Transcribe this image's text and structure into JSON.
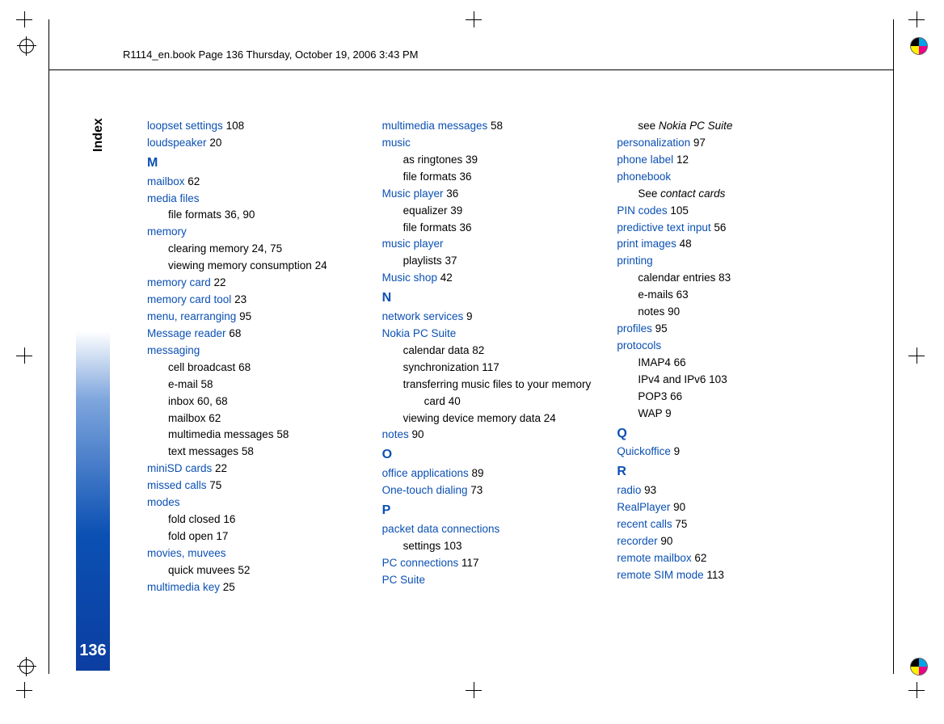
{
  "header": "R1114_en.book  Page 136  Thursday, October 19, 2006  3:43 PM",
  "side_label": "Index",
  "page_number": "136",
  "col1": {
    "loopset_settings": "loopset settings",
    "loopset_settings_pg": "108",
    "loudspeaker": "loudspeaker",
    "loudspeaker_pg": "20",
    "M": "M",
    "mailbox": "mailbox",
    "mailbox_pg": "62",
    "media_files": "media files",
    "mf_file_formats": "file formats",
    "mf_file_formats_pg": "36, 90",
    "memory": "memory",
    "mem_clearing": "clearing memory",
    "mem_clearing_pg": "24, 75",
    "mem_viewing": "viewing memory consumption",
    "mem_viewing_pg": "24",
    "memory_card": "memory card",
    "memory_card_pg": "22",
    "memory_card_tool": "memory card tool",
    "memory_card_tool_pg": "23",
    "menu_rearranging": "menu, rearranging",
    "menu_rearranging_pg": "95",
    "message_reader": "Message reader",
    "message_reader_pg": "68",
    "messaging": "messaging",
    "msg_cb": "cell broadcast",
    "msg_cb_pg": "68",
    "msg_email": "e-mail",
    "msg_email_pg": "58",
    "msg_inbox": "inbox",
    "msg_inbox_pg": "60, 68",
    "msg_mailbox": "mailbox",
    "msg_mailbox_pg": "62",
    "msg_mm": "multimedia messages",
    "msg_mm_pg": "58",
    "msg_text": "text messages",
    "msg_text_pg": "58",
    "mini_sd": "miniSD cards",
    "mini_sd_pg": "22",
    "missed_calls": "missed calls",
    "missed_calls_pg": "75",
    "modes": "modes",
    "fold_closed": "fold closed",
    "fold_closed_pg": "16",
    "fold_open": "fold open",
    "fold_open_pg": "17",
    "movies": "movies, muvees",
    "quick_muvees": "quick muvees",
    "quick_muvees_pg": "52",
    "mm_key": "multimedia key",
    "mm_key_pg": "25"
  },
  "col2": {
    "mm_messages": "multimedia messages",
    "mm_messages_pg": "58",
    "music": "music",
    "ringtones": "as ringtones",
    "ringtones_pg": "39",
    "music_ff": "file formats",
    "music_ff_pg": "36",
    "music_player_cap": "Music player",
    "music_player_cap_pg": "36",
    "equalizer": "equalizer",
    "equalizer_pg": "39",
    "mp_ff": "file formats",
    "mp_ff_pg": "36",
    "music_player_lc": "music player",
    "playlists": "playlists",
    "playlists_pg": "37",
    "music_shop": "Music shop",
    "music_shop_pg": "42",
    "N": "N",
    "network_services": "network services",
    "network_services_pg": "9",
    "nokia_pc": "Nokia PC Suite",
    "npc_cal": "calendar data",
    "npc_cal_pg": "82",
    "npc_sync": "synchronization",
    "npc_sync_pg": "117",
    "npc_transfer": "transferring music files to your memory card",
    "npc_transfer_pg": "40",
    "npc_view": "viewing device memory data",
    "npc_view_pg": "24",
    "notes": "notes",
    "notes_pg": "90",
    "O": "O",
    "office": "office applications",
    "office_pg": "89",
    "onetouch": "One-touch dialing",
    "onetouch_pg": "73",
    "P": "P",
    "packet": "packet data connections",
    "pk_settings": "settings",
    "pk_settings_pg": "103",
    "pc_conn": "PC connections",
    "pc_conn_pg": "117",
    "pc_suite": "PC Suite"
  },
  "col3": {
    "see": "see ",
    "see_target": "Nokia PC Suite",
    "personalization": "personalization",
    "personalization_pg": "97",
    "phone_label": "phone label",
    "phone_label_pg": "12",
    "phonebook": "phonebook",
    "see2": "See ",
    "see2_target": "contact cards",
    "pin": "PIN codes",
    "pin_pg": "105",
    "pred": "predictive text input",
    "pred_pg": "56",
    "print_img": "print images",
    "print_img_pg": "48",
    "printing": "printing",
    "cal_entries": "calendar entries",
    "cal_entries_pg": "83",
    "emails": "e-mails",
    "emails_pg": "63",
    "notes_sub": "notes",
    "notes_sub_pg": "90",
    "profiles": "profiles",
    "profiles_pg": "95",
    "protocols": "protocols",
    "imap": "IMAP4",
    "imap_pg": "66",
    "ipv": "IPv4 and IPv6",
    "ipv_pg": "103",
    "pop3": "POP3",
    "pop3_pg": "66",
    "wap": "WAP",
    "wap_pg": "9",
    "Q": "Q",
    "quick": "Quickoffice",
    "quick_pg": "9",
    "R": "R",
    "radio": "radio",
    "radio_pg": "93",
    "real": "RealPlayer",
    "real_pg": "90",
    "recent": "recent calls",
    "recent_pg": "75",
    "recorder": "recorder",
    "recorder_pg": "90",
    "remote_mb": "remote mailbox",
    "remote_mb_pg": "62",
    "remote_sim": "remote SIM mode",
    "remote_sim_pg": "113"
  }
}
